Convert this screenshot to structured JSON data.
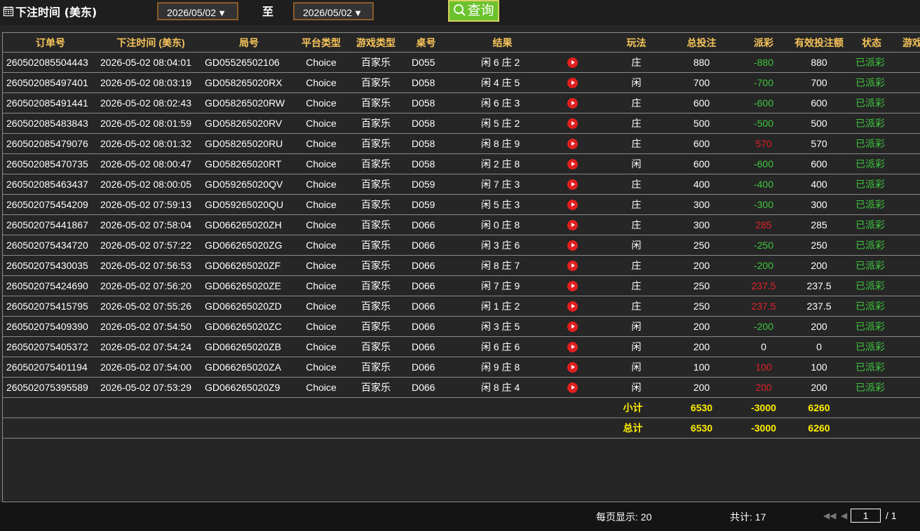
{
  "toolbar": {
    "title": "下注时间 (美东)",
    "start_date": "2026/05/02",
    "separator": "至",
    "end_date": "2026/05/02",
    "query_label": "查询"
  },
  "columns": [
    "订单号",
    "下注时间 (美东)",
    "局号",
    "平台类型",
    "游戏类型",
    "桌号",
    "结果",
    "",
    "玩法",
    "总投注",
    "派彩",
    "有效投注额",
    "状态",
    "游戏"
  ],
  "rows": [
    {
      "order": "260502085504443",
      "time": "2026-05-02 08:04:01",
      "round": "GD05526502106",
      "platform": "Choice",
      "game": "百家乐",
      "table": "D055",
      "result": "闲 6 庄 2",
      "bet": "庄",
      "total": "880",
      "payout": "-880",
      "payout_color": "green",
      "valid": "880",
      "status": "已派彩"
    },
    {
      "order": "260502085497401",
      "time": "2026-05-02 08:03:19",
      "round": "GD058265020RX",
      "platform": "Choice",
      "game": "百家乐",
      "table": "D058",
      "result": "闲 4 庄 5",
      "bet": "闲",
      "total": "700",
      "payout": "-700",
      "payout_color": "green",
      "valid": "700",
      "status": "已派彩"
    },
    {
      "order": "260502085491441",
      "time": "2026-05-02 08:02:43",
      "round": "GD058265020RW",
      "platform": "Choice",
      "game": "百家乐",
      "table": "D058",
      "result": "闲 6 庄 3",
      "bet": "庄",
      "total": "600",
      "payout": "-600",
      "payout_color": "green",
      "valid": "600",
      "status": "已派彩"
    },
    {
      "order": "260502085483843",
      "time": "2026-05-02 08:01:59",
      "round": "GD058265020RV",
      "platform": "Choice",
      "game": "百家乐",
      "table": "D058",
      "result": "闲 5 庄 2",
      "bet": "庄",
      "total": "500",
      "payout": "-500",
      "payout_color": "green",
      "valid": "500",
      "status": "已派彩"
    },
    {
      "order": "260502085479076",
      "time": "2026-05-02 08:01:32",
      "round": "GD058265020RU",
      "platform": "Choice",
      "game": "百家乐",
      "table": "D058",
      "result": "闲 8 庄 9",
      "bet": "庄",
      "total": "600",
      "payout": "570",
      "payout_color": "red",
      "valid": "570",
      "status": "已派彩"
    },
    {
      "order": "260502085470735",
      "time": "2026-05-02 08:00:47",
      "round": "GD058265020RT",
      "platform": "Choice",
      "game": "百家乐",
      "table": "D058",
      "result": "闲 2 庄 8",
      "bet": "闲",
      "total": "600",
      "payout": "-600",
      "payout_color": "green",
      "valid": "600",
      "status": "已派彩"
    },
    {
      "order": "260502085463437",
      "time": "2026-05-02 08:00:05",
      "round": "GD059265020QV",
      "platform": "Choice",
      "game": "百家乐",
      "table": "D059",
      "result": "闲 7 庄 3",
      "bet": "庄",
      "total": "400",
      "payout": "-400",
      "payout_color": "green",
      "valid": "400",
      "status": "已派彩"
    },
    {
      "order": "260502075454209",
      "time": "2026-05-02 07:59:13",
      "round": "GD059265020QU",
      "platform": "Choice",
      "game": "百家乐",
      "table": "D059",
      "result": "闲 5 庄 3",
      "bet": "庄",
      "total": "300",
      "payout": "-300",
      "payout_color": "green",
      "valid": "300",
      "status": "已派彩"
    },
    {
      "order": "260502075441867",
      "time": "2026-05-02 07:58:04",
      "round": "GD066265020ZH",
      "platform": "Choice",
      "game": "百家乐",
      "table": "D066",
      "result": "闲 0 庄 8",
      "bet": "庄",
      "total": "300",
      "payout": "285",
      "payout_color": "red",
      "valid": "285",
      "status": "已派彩"
    },
    {
      "order": "260502075434720",
      "time": "2026-05-02 07:57:22",
      "round": "GD066265020ZG",
      "platform": "Choice",
      "game": "百家乐",
      "table": "D066",
      "result": "闲 3 庄 6",
      "bet": "闲",
      "total": "250",
      "payout": "-250",
      "payout_color": "green",
      "valid": "250",
      "status": "已派彩"
    },
    {
      "order": "260502075430035",
      "time": "2026-05-02 07:56:53",
      "round": "GD066265020ZF",
      "platform": "Choice",
      "game": "百家乐",
      "table": "D066",
      "result": "闲 8 庄 7",
      "bet": "庄",
      "total": "200",
      "payout": "-200",
      "payout_color": "green",
      "valid": "200",
      "status": "已派彩"
    },
    {
      "order": "260502075424690",
      "time": "2026-05-02 07:56:20",
      "round": "GD066265020ZE",
      "platform": "Choice",
      "game": "百家乐",
      "table": "D066",
      "result": "闲 7 庄 9",
      "bet": "庄",
      "total": "250",
      "payout": "237.5",
      "payout_color": "red",
      "valid": "237.5",
      "status": "已派彩"
    },
    {
      "order": "260502075415795",
      "time": "2026-05-02 07:55:26",
      "round": "GD066265020ZD",
      "platform": "Choice",
      "game": "百家乐",
      "table": "D066",
      "result": "闲 1 庄 2",
      "bet": "庄",
      "total": "250",
      "payout": "237.5",
      "payout_color": "red",
      "valid": "237.5",
      "status": "已派彩"
    },
    {
      "order": "260502075409390",
      "time": "2026-05-02 07:54:50",
      "round": "GD066265020ZC",
      "platform": "Choice",
      "game": "百家乐",
      "table": "D066",
      "result": "闲 3 庄 5",
      "bet": "闲",
      "total": "200",
      "payout": "-200",
      "payout_color": "green",
      "valid": "200",
      "status": "已派彩"
    },
    {
      "order": "260502075405372",
      "time": "2026-05-02 07:54:24",
      "round": "GD066265020ZB",
      "platform": "Choice",
      "game": "百家乐",
      "table": "D066",
      "result": "闲 6 庄 6",
      "bet": "闲",
      "total": "200",
      "payout": "0",
      "payout_color": "white",
      "valid": "0",
      "status": "已派彩"
    },
    {
      "order": "260502075401194",
      "time": "2026-05-02 07:54:00",
      "round": "GD066265020ZA",
      "platform": "Choice",
      "game": "百家乐",
      "table": "D066",
      "result": "闲 9 庄 8",
      "bet": "闲",
      "total": "100",
      "payout": "100",
      "payout_color": "red",
      "valid": "100",
      "status": "已派彩"
    },
    {
      "order": "260502075395589",
      "time": "2026-05-02 07:53:29",
      "round": "GD066265020Z9",
      "platform": "Choice",
      "game": "百家乐",
      "table": "D066",
      "result": "闲 8 庄 4",
      "bet": "闲",
      "total": "200",
      "payout": "200",
      "payout_color": "red",
      "valid": "200",
      "status": "已派彩"
    }
  ],
  "subtotal": {
    "label": "小计",
    "total": "6530",
    "payout": "-3000",
    "valid": "6260"
  },
  "grand_total": {
    "label": "总计",
    "total": "6530",
    "payout": "-3000",
    "valid": "6260"
  },
  "footer": {
    "per_page": "每页显示: 20",
    "count": "共计: 17",
    "page_value": "1",
    "page_total": "/  1"
  },
  "colors": {
    "header": "#f5c35a",
    "win": "#e0202a",
    "loss": "#3ec63e",
    "total": "#ffee00",
    "status": "#3ec63e"
  },
  "icons": [
    "calendar-icon",
    "search-icon",
    "play-video-icon",
    "first-page-icon",
    "prev-page-icon"
  ]
}
